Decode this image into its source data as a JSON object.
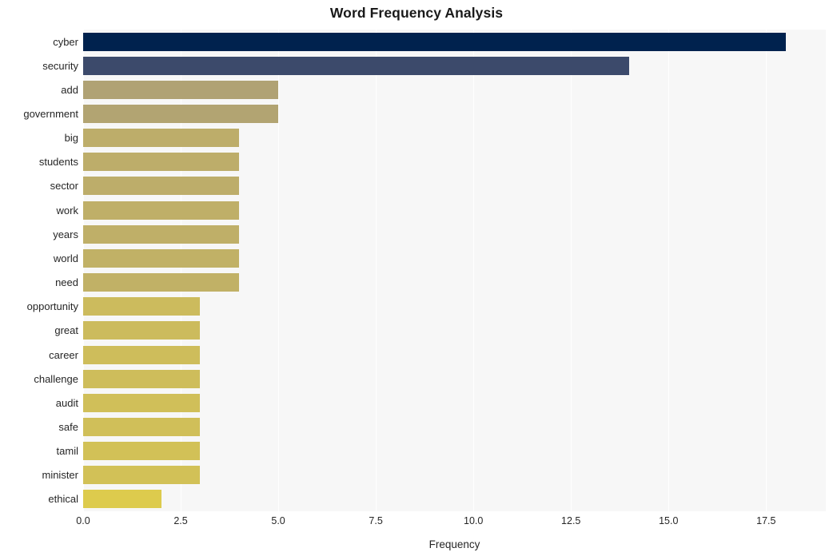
{
  "chart_data": {
    "type": "bar",
    "orientation": "horizontal",
    "title": "Word Frequency Analysis",
    "xlabel": "Frequency",
    "ylabel": "",
    "categories": [
      "cyber",
      "security",
      "add",
      "government",
      "big",
      "students",
      "sector",
      "work",
      "years",
      "world",
      "need",
      "opportunity",
      "great",
      "career",
      "challenge",
      "audit",
      "safe",
      "tamil",
      "minister",
      "ethical"
    ],
    "values": [
      18,
      14,
      5,
      5,
      4,
      4,
      4,
      4,
      4,
      4,
      4,
      3,
      3,
      3,
      3,
      3,
      3,
      3,
      3,
      2
    ],
    "bar_colors": [
      "#00224e",
      "#3c4a6b",
      "#b0a274",
      "#b2a472",
      "#bdad6a",
      "#bdad6a",
      "#bdad6a",
      "#bfaf68",
      "#bfaf68",
      "#c1b166",
      "#c1b166",
      "#ccbb5d",
      "#ccbb5d",
      "#cebd5b",
      "#cebd5b",
      "#d0bf59",
      "#d0bf59",
      "#d2c157",
      "#d2c157",
      "#ddcb4d"
    ],
    "xlim": [
      0,
      19.03
    ],
    "xticks": [
      0.0,
      2.5,
      5.0,
      7.5,
      10.0,
      12.5,
      15.0,
      17.5
    ],
    "xtick_labels": [
      "0.0",
      "2.5",
      "5.0",
      "7.5",
      "10.0",
      "12.5",
      "15.0",
      "17.5"
    ],
    "grid": true,
    "grid_color": "#ffffff",
    "plot_background": "#f7f7f7",
    "figure_background": "#ffffff",
    "legend": null,
    "colormap": "cividis"
  }
}
